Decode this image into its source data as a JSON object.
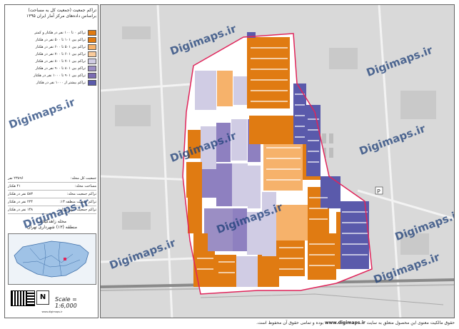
{
  "title": {
    "line1": "تراکم جمعیت (جمعیت کل به مساحت)",
    "line2": "براساس داده‌های مرکز آمار ایران ۱۳۹۵"
  },
  "legend": [
    {
      "label": "تراکم ۰ تا ۱۰۰ نفر در هکتار و کمتر",
      "color": "#e07b12"
    },
    {
      "label": "تراکم بین ۱۰۱ تا ۵۰۰ نفر در هکتار",
      "color": "#e07b12"
    },
    {
      "label": "تراکم بین ۵۰۱ تا ۶۰۰ نفر در هکتار",
      "color": "#f6b26b"
    },
    {
      "label": "تراکم بین ۶۰۱ تا ۷۰۰ نفر در هکتار",
      "color": "#f9cb9c"
    },
    {
      "label": "تراکم بین ۷۰۱ تا ۸۰۰ نفر در هکتار",
      "color": "#d0cce4"
    },
    {
      "label": "تراکم بین ۸۰۱ تا ۹۰۰ نفر در هکتار",
      "color": "#9b8ec4"
    },
    {
      "label": "تراکم بین ۹۰۱ تا ۱۰۰۰ نفر در هکتار",
      "color": "#7b6cb3"
    },
    {
      "label": "تراکم بیشتر از ۱۰۰۰ نفر در هکتار",
      "color": "#5a5aab"
    }
  ],
  "stats": [
    {
      "label": "جمعیت کل محله:",
      "value": "۲۳۸۹۶ نفر"
    },
    {
      "label": "مساحت محله:",
      "value": "۴۱ هکتار"
    },
    {
      "label": "تراکم جمعیت محله:",
      "value": "۵۸۳ نفر در هکتار"
    },
    {
      "label": "تراکم جمعیت منطقه ۱۳:",
      "value": "۲۲۴ نفر در هکتار"
    },
    {
      "label": "تراکم جمعیت شهر تهران:",
      "value": "۱۴۸ نفر در هکتار"
    }
  ],
  "region": {
    "line1": "محله زاهدگیلانی",
    "line2": "منطقه (۱۳) شهرداری تهران"
  },
  "scale": "Scale = 1:6,000",
  "north": "N",
  "footer": {
    "prefix": "حقوق مالکیت معنوی این محصول متعلق به سایت",
    "site": "www.digimaps.ir",
    "suffix": "بوده و تمامی حقوق آن محفوظ است."
  },
  "watermark": "Digimaps.ir",
  "parking": "P",
  "colors": {
    "orange": "#e07b12",
    "light_orange": "#f6b26b",
    "lavender": "#d0cce4",
    "purple": "#8e80c0",
    "blue": "#5a5aab",
    "boundary": "#e0245a",
    "background": "#d9d9d9"
  }
}
